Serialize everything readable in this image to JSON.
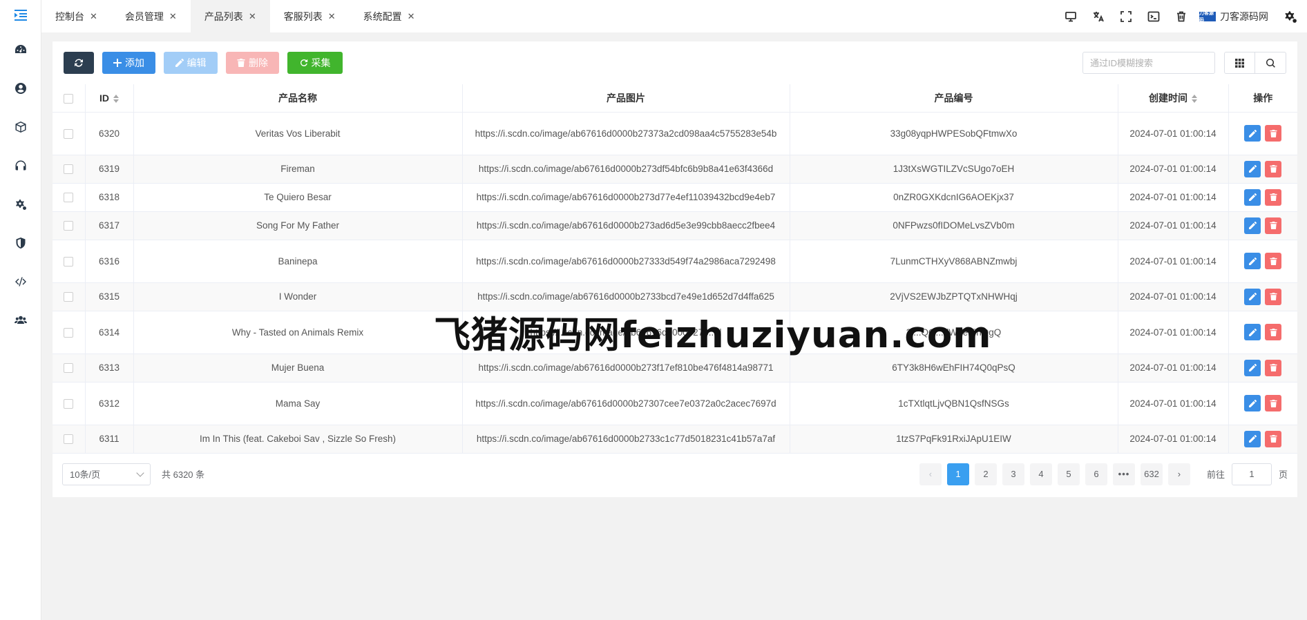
{
  "sidebar": {
    "items": [
      {
        "icon": "dashboard-icon"
      },
      {
        "icon": "user-circle-icon"
      },
      {
        "icon": "box-icon"
      },
      {
        "icon": "headset-icon"
      },
      {
        "icon": "cogs-icon"
      },
      {
        "icon": "shield-icon"
      },
      {
        "icon": "code-icon"
      },
      {
        "icon": "users-icon"
      }
    ]
  },
  "tabs": [
    {
      "label": "控制台",
      "active": false
    },
    {
      "label": "会员管理",
      "active": false
    },
    {
      "label": "产品列表",
      "active": true
    },
    {
      "label": "客服列表",
      "active": false
    },
    {
      "label": "系统配置",
      "active": false
    }
  ],
  "topbar": {
    "brand_logo_text": "刀客源码",
    "brand_name": "刀客源码网"
  },
  "toolbar": {
    "add_label": "添加",
    "edit_label": "编辑",
    "delete_label": "删除",
    "collect_label": "采集",
    "search_placeholder": "通过ID模糊搜索"
  },
  "table": {
    "columns": [
      "ID",
      "产品名称",
      "产品图片",
      "产品编号",
      "创建时间",
      "操作"
    ],
    "rows": [
      {
        "id": "6320",
        "name": "Veritas Vos Liberabit",
        "image": "https://i.scdn.co/image/ab67616d0000b27373a2cd098aa4c5755283e54b",
        "code": "33g08yqpHWPESobQFtmwXo",
        "created": "2024-07-01 01:00:14"
      },
      {
        "id": "6319",
        "name": "Fireman",
        "image": "https://i.scdn.co/image/ab67616d0000b273df54bfc6b9b8a41e63f4366d",
        "code": "1J3tXsWGTILZVcSUgo7oEH",
        "created": "2024-07-01 01:00:14"
      },
      {
        "id": "6318",
        "name": "Te Quiero Besar",
        "image": "https://i.scdn.co/image/ab67616d0000b273d77e4ef11039432bcd9e4eb7",
        "code": "0nZR0GXKdcnIG6AOEKjx37",
        "created": "2024-07-01 01:00:14"
      },
      {
        "id": "6317",
        "name": "Song For My Father",
        "image": "https://i.scdn.co/image/ab67616d0000b273ad6d5e3e99cbb8aecc2fbee4",
        "code": "0NFPwzs0fIDOMeLvsZVb0m",
        "created": "2024-07-01 01:00:14"
      },
      {
        "id": "6316",
        "name": "Baninepa",
        "image": "https://i.scdn.co/image/ab67616d0000b27333d549f74a2986aca7292498",
        "code": "7LunmCTHXyV868ABNZmwbj",
        "created": "2024-07-01 01:00:14"
      },
      {
        "id": "6315",
        "name": "I Wonder",
        "image": "https://i.scdn.co/image/ab67616d0000b2733bcd7e49e1d652d7d4ffa625",
        "code": "2VjVS2EWJbZPTQTxNHWHqj",
        "created": "2024-07-01 01:00:14"
      },
      {
        "id": "6314",
        "name": "Why - Tasted on Animals Remix",
        "image": "https://i.scdn.co/image/ab67616d0000b273...d",
        "code": "3i...QQ...dWYer5nQgQ",
        "created": "2024-07-01 01:00:14"
      },
      {
        "id": "6313",
        "name": "Mujer Buena",
        "image": "https://i.scdn.co/image/ab67616d0000b273f17ef810be476f4814a98771",
        "code": "6TY3k8H6wEhFIH74Q0qPsQ",
        "created": "2024-07-01 01:00:14"
      },
      {
        "id": "6312",
        "name": "Mama Say",
        "image": "https://i.scdn.co/image/ab67616d0000b27307cee7e0372a0c2acec7697d",
        "code": "1cTXtlqtLjvQBN1QsfNSGs",
        "created": "2024-07-01 01:00:14"
      },
      {
        "id": "6311",
        "name": "Im In This (feat. Cakeboi Sav , Sizzle So Fresh)",
        "image": "https://i.scdn.co/image/ab67616d0000b2733c1c77d5018231c41b57a7af",
        "code": "1tzS7PqFk91RxiJApU1EIW",
        "created": "2024-07-01 01:00:14"
      }
    ]
  },
  "pagination": {
    "page_size_label": "10条/页",
    "total_label": "共 6320 条",
    "prev": "‹",
    "next": "›",
    "pages": [
      "1",
      "2",
      "3",
      "4",
      "5",
      "6"
    ],
    "more": "•••",
    "last_page": "632",
    "current_page": "1",
    "goto_prefix": "前往",
    "goto_value": "1",
    "goto_suffix": "页"
  },
  "watermark": "飞猪源码网feizhuziyuan.com",
  "colors": {
    "primary": "#3a8ee6",
    "danger": "#f56c6c",
    "success": "#41b52d",
    "dark": "#2c3e50",
    "page_active": "#3a9ff0"
  }
}
